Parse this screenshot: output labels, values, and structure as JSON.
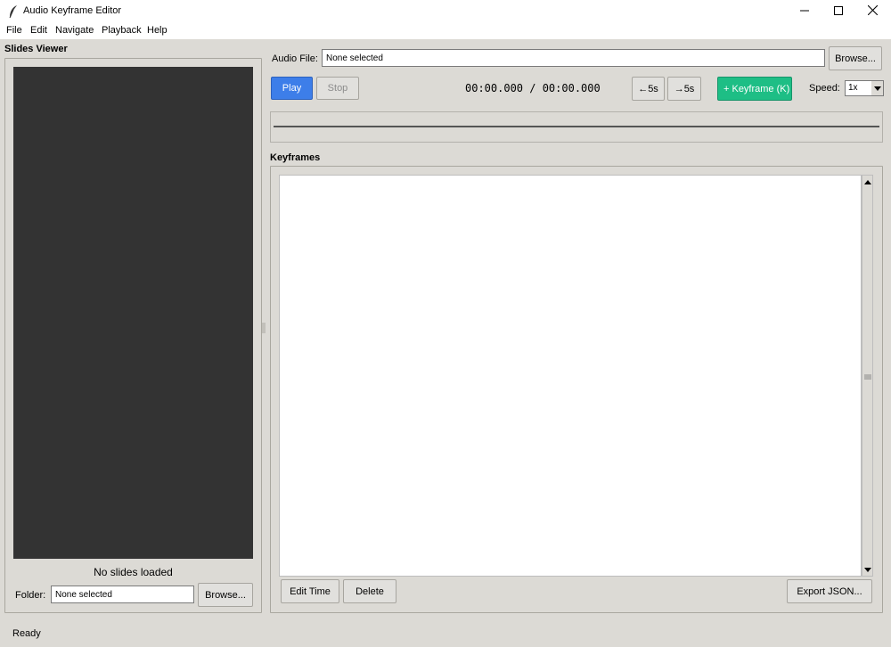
{
  "window": {
    "title": "Audio Keyframe Editor"
  },
  "menu": [
    "File",
    "Edit",
    "Navigate",
    "Playback",
    "Help"
  ],
  "slides": {
    "header": "Slides Viewer",
    "empty_text": "No slides loaded",
    "folder_label": "Folder:",
    "folder_value": "None selected",
    "browse_label": "Browse..."
  },
  "audio": {
    "label": "Audio File:",
    "value": "None selected",
    "browse_label": "Browse..."
  },
  "transport": {
    "play_label": "Play",
    "stop_label": "Stop",
    "time_display": "00:00.000 / 00:00.000",
    "back_label": "←5s",
    "forward_label": "→5s",
    "keyframe_label": "+ Keyframe (K)",
    "speed_label": "Speed:",
    "speed_value": "1x"
  },
  "keyframes": {
    "header": "Keyframes",
    "edit_label": "Edit Time",
    "delete_label": "Delete",
    "export_label": "Export JSON..."
  },
  "status": {
    "text": "Ready"
  },
  "colors": {
    "play_button": "#3d7ee9",
    "keyframe_button": "#1ebe85",
    "slide_canvas": "#333333",
    "window_bg": "#dcdad5"
  }
}
